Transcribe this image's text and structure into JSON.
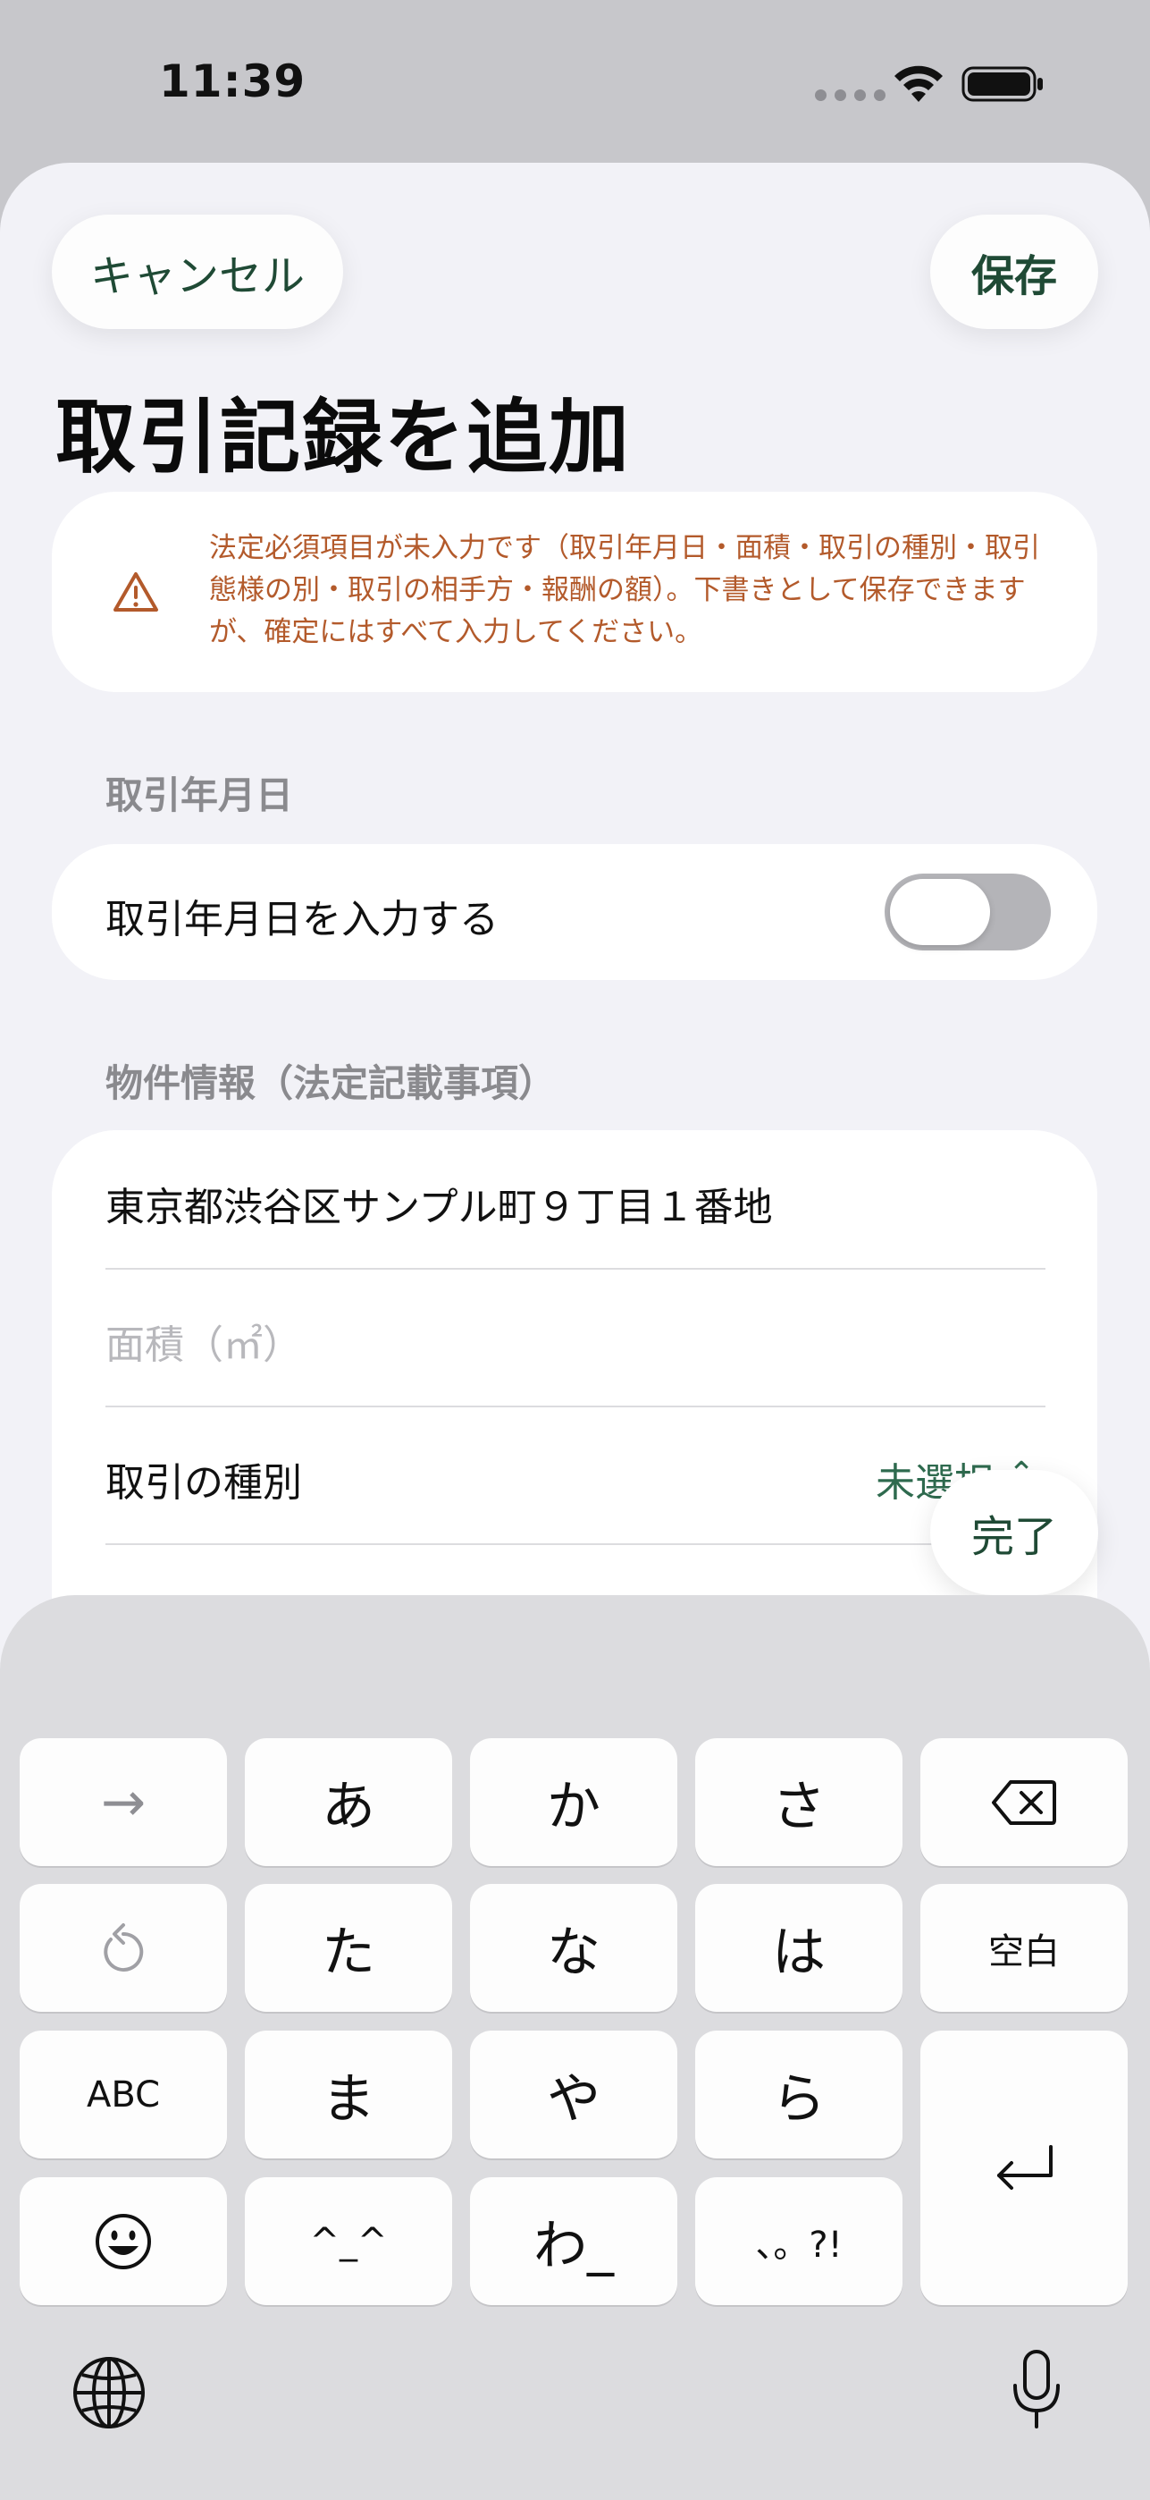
{
  "status_bar": {
    "time": "11:39"
  },
  "header": {
    "cancel_label": "キャンセル",
    "save_label": "保存",
    "title": "取引記録を追加"
  },
  "warning": {
    "text": "法定必須項目が未入力です（取引年月日・面積・取引の種別・取引態様の別・取引の相手方・報酬の額）。下書きとして保存できますが、確定にはすべて入力してください。"
  },
  "date_section": {
    "header": "取引年月日",
    "toggle_label": "取引年月日を入力する",
    "toggle_on": false
  },
  "property_section": {
    "header": "物件情報（法定記載事項）",
    "address_value": "東京都渋谷区サンプル町９丁目１番地",
    "area_placeholder": "面積（㎡）",
    "transaction_type_label": "取引の種別",
    "transaction_type_value": "未選択"
  },
  "done_label": "完了",
  "keyboard": {
    "row1": [
      "→",
      "あ",
      "か",
      "さ",
      "delete"
    ],
    "row2": [
      "undo",
      "た",
      "な",
      "は",
      "空白"
    ],
    "row3": [
      "ABC",
      "ま",
      "や",
      "ら",
      "enter"
    ],
    "row4": [
      "emoji",
      "^_^",
      "わ_",
      "、。?!"
    ]
  },
  "colors": {
    "accent": "#1f4a35",
    "warning": "#b35a2b",
    "background": "#f2f2f7"
  }
}
